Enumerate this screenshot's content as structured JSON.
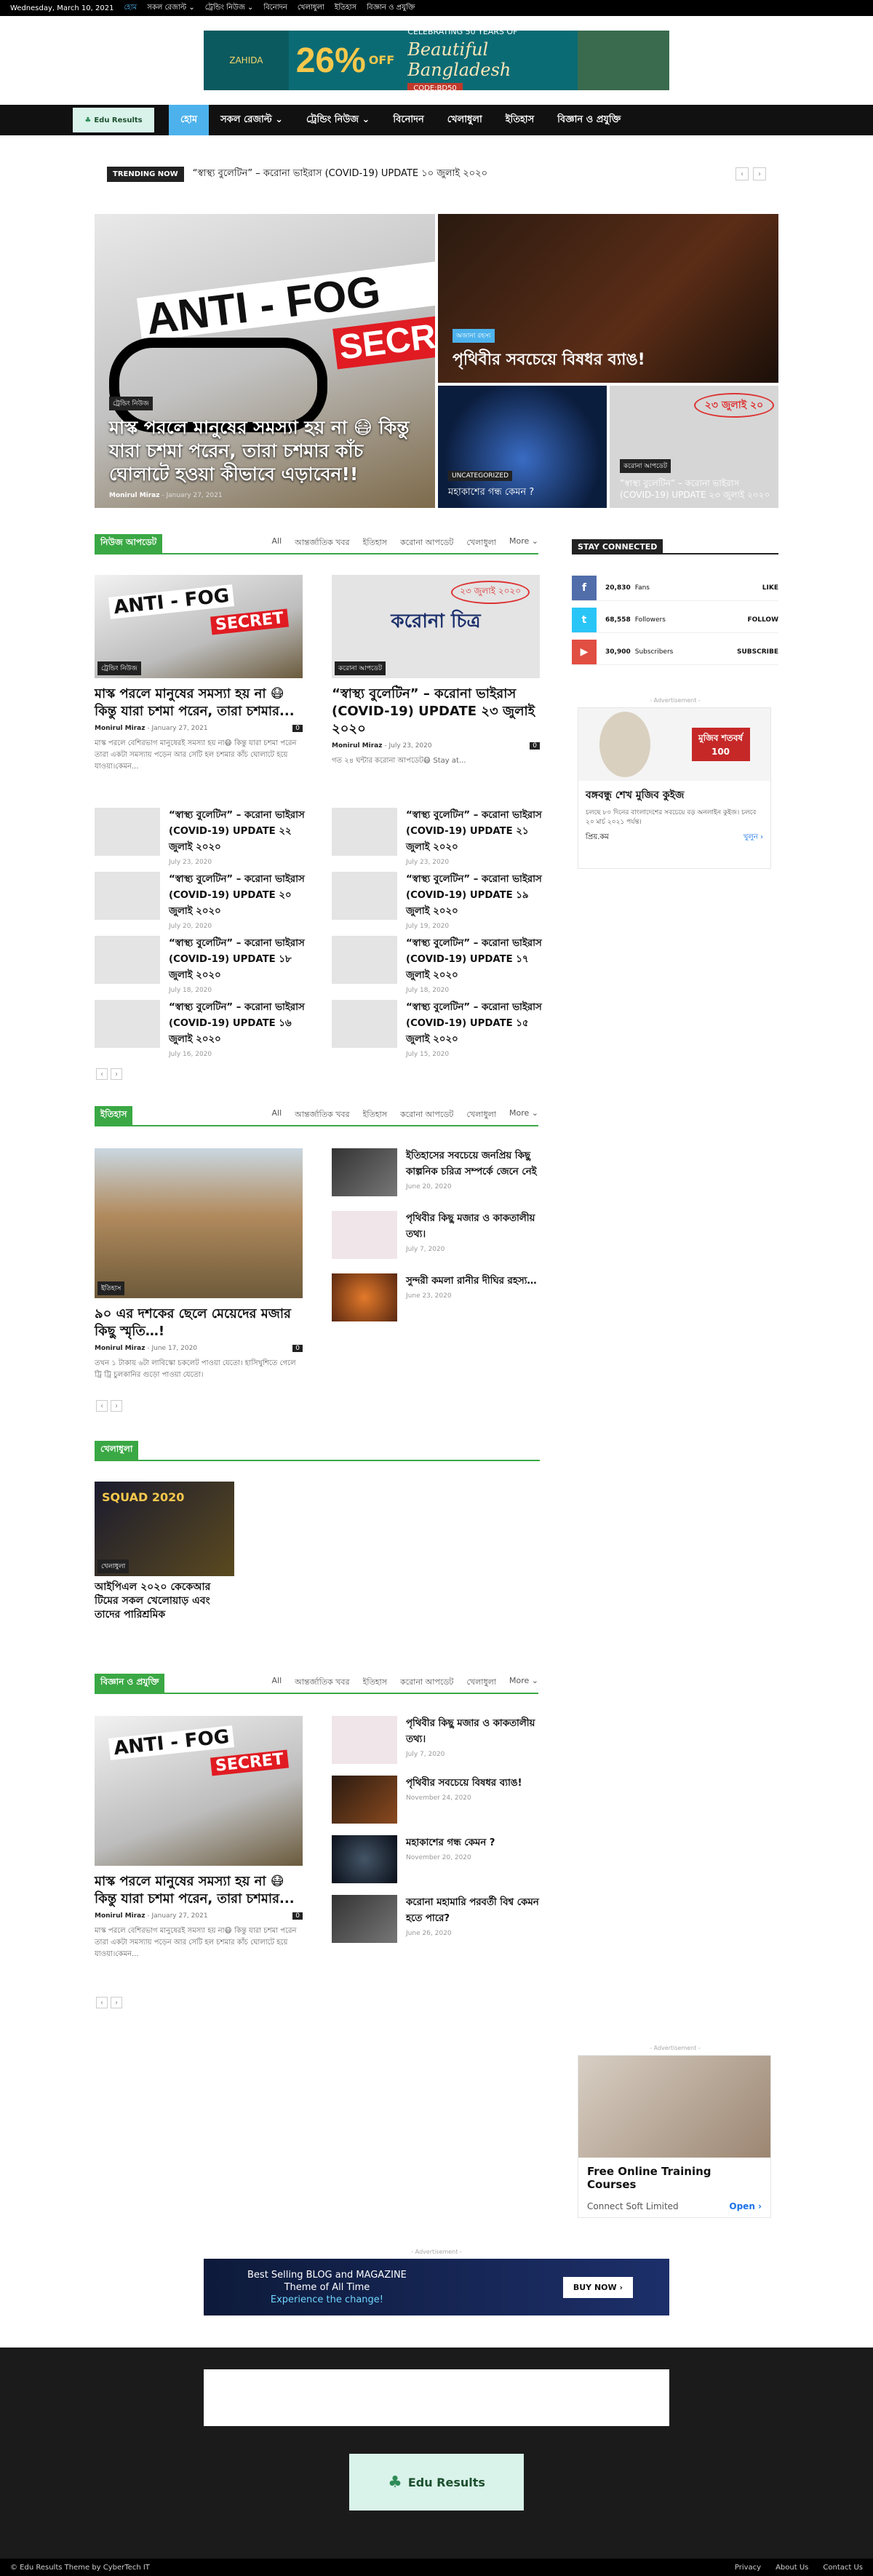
{
  "topbar": {
    "date": "Wednesday, March 10, 2021",
    "items": [
      "হোম",
      "সকল রেজাল্ট ⌄",
      "ট্রেন্ডিং নিউজ ⌄",
      "বিনোদন",
      "খেলাধুলা",
      "ইতিহাস",
      "বিজ্ঞান ও প্রযুক্তি"
    ]
  },
  "top_ad": {
    "brand": "ZAHIDA",
    "percent": "26%",
    "off": "OFF",
    "line1": "CELEBRATING 50 YEARS OF",
    "line2": "Beautiful Bangladesh",
    "code": "CODE:BD50"
  },
  "nav": {
    "logo_text": "Edu Results",
    "items": [
      "হোম",
      "সকল রেজাল্ট ⌄",
      "ট্রেন্ডিং নিউজ ⌄",
      "বিনোদন",
      "খেলাধুলা",
      "ইতিহাস",
      "বিজ্ঞান ও প্রযুক্তি"
    ]
  },
  "trending": {
    "label": "TRENDING NOW",
    "text": "“স্বাস্থ্য বুলেটিন” – করোনা ভাইরাস (COVID-19) UPDATE ১০ জুলাই ২০২০"
  },
  "hero": {
    "main": {
      "banner1": "ANTI - FOG",
      "banner2": "SECRET",
      "category": "ট্রেন্ডিং নিউজ",
      "title": "মাস্ক পরলে মানুষের সমস্যা হয় না 😷 কিন্তু যারা চশমা পরেন, তারা চশমার কাঁচ ঘোলাটে হওয়া কীভাবে এড়াবেন!!",
      "author": "Monirul Miraz",
      "date": "January 27, 2021"
    },
    "top_right": {
      "category": "অজানা রহস্য",
      "title": "পৃথিবীর সবচেয়ে বিষধর ব্যাঙ!"
    },
    "bottom_left": {
      "category": "UNCATEGORIZED",
      "title": "মহাকাশের গন্ধ কেমন ?"
    },
    "bottom_right": {
      "category": "করোনা আপডেট",
      "stamp": "২৩ জুলাই ২০",
      "title": "“স্বাস্থ্য বুলেটিন” – করোনা ভাইরাস (COVID-19) UPDATE ২৩ জুলাই ২০২০"
    }
  },
  "sec_news": {
    "title": "নিউজ আপডেট",
    "tabs": [
      "All",
      "আন্তর্জাতিক খবর",
      "ইতিহাস",
      "করোনা আপডেট",
      "খেলাধুলা",
      "More ⌄"
    ],
    "big1": {
      "category": "ট্রেন্ডিং নিউজ",
      "title": "মাস্ক পরলে মানুষের সমস্যা হয় না 😷 কিন্তু যারা চশমা পরেন, তারা চশমার...",
      "author": "Monirul Miraz",
      "date": "January 27, 2021",
      "comments": "0",
      "excerpt": "মাস্ক পরলে বেশিরভাগ মানুষেরই সমস্যা হয় না😷 কিন্তু যারা চশমা পরেন তারা একটা সমস্যায় পড়েন আর সেটি হল চশমার কাঁচ ঘোলাটে হয়ে যাওয়া।কেমন..."
    },
    "big2": {
      "category": "করোনা আপডেট",
      "stamp": "২৩ জুলাই ২০২০",
      "banner": "করোনা চিত্র",
      "title": "“স্বাস্থ্য বুলেটিন” – করোনা ভাইরাস (COVID-19) UPDATE ২৩ জুলাই ২০২০",
      "author": "Monirul Miraz",
      "date": "July 23, 2020",
      "comments": "0",
      "excerpt": "গত ২৪ ঘন্টার করোনা আপডেট😷 Stay at..."
    },
    "small": [
      {
        "title": "“স্বাস্থ্য বুলেটিন” – করোনা ভাইরাস (COVID-19) UPDATE ২২ জুলাই ২০২০",
        "date": "July 23, 2020"
      },
      {
        "title": "“স্বাস্থ্য বুলেটিন” – করোনা ভাইরাস (COVID-19) UPDATE ২১ জুলাই ২০২০",
        "date": "July 23, 2020"
      },
      {
        "title": "“স্বাস্থ্য বুলেটিন” – করোনা ভাইরাস (COVID-19) UPDATE ২০ জুলাই ২০২০",
        "date": "July 20, 2020"
      },
      {
        "title": "“স্বাস্থ্য বুলেটিন” – করোনা ভাইরাস (COVID-19) UPDATE ১৯ জুলাই ২০২০",
        "date": "July 19, 2020"
      },
      {
        "title": "“স্বাস্থ্য বুলেটিন” – করোনা ভাইরাস (COVID-19) UPDATE ১৮ জুলাই ২০২০",
        "date": "July 18, 2020"
      },
      {
        "title": "“স্বাস্থ্য বুলেটিন” – করোনা ভাইরাস (COVID-19) UPDATE ১৭ জুলাই ২০২০",
        "date": "July 18, 2020"
      },
      {
        "title": "“স্বাস্থ্য বুলেটিন” – করোনা ভাইরাস (COVID-19) UPDATE ১৬ জুলাই ২০২০",
        "date": "July 16, 2020"
      },
      {
        "title": "“স্বাস্থ্য বুলেটিন” – করোনা ভাইরাস (COVID-19) UPDATE ১৫ জুলাই ২০২০",
        "date": "July 15, 2020"
      }
    ]
  },
  "sidebar": {
    "title": "STAY CONNECTED",
    "social": [
      {
        "icon": "f",
        "count": "20,830",
        "label": "Fans",
        "action": "LIKE",
        "color": "#516eab"
      },
      {
        "icon": "t",
        "count": "68,558",
        "label": "Followers",
        "action": "FOLLOW",
        "color": "#29c5f6"
      },
      {
        "icon": "▶",
        "count": "30,900",
        "label": "Subscribers",
        "action": "SUBSCRIBE",
        "color": "#e14e42"
      }
    ],
    "ad1": {
      "label": "- Advertisement -",
      "headline": "বঙ্গবন্ধু শেখ মুজিব কুইজ",
      "badge": "মুজিব শতবর্ষ 100",
      "desc": "চলছে ৮০ দিনের বাংলাদেশের সবচেয়ে বড় অনলাইন কুইজ। চলবে ২০ মার্চ ২০২১ পর্যন্ত।",
      "brand": "প্রিয়.কম",
      "cta": "খুলুন ›"
    },
    "ad2": {
      "label": "- Advertisement -",
      "headline": "Free Online Training Courses",
      "brand": "Connect Soft Limited",
      "cta": "Open ›"
    }
  },
  "sec_history": {
    "title": "ইতিহাস",
    "tabs": [
      "All",
      "আন্তর্জাতিক খবর",
      "ইতিহাস",
      "করোনা আপডেট",
      "খেলাধুলা",
      "More ⌄"
    ],
    "big": {
      "category": "ইতিহাস",
      "title": "৯০ এর দশকের ছেলে মেয়েদের মজার কিছু স্মৃতি…!",
      "author": "Monirul Miraz",
      "date": "June 17, 2020",
      "comments": "0",
      "excerpt": "তখন ১ টাকায় ৬টা লাবিস্কো চকলেট পাওয়া যেতো। হাসিখুশিতে গেলে ট্রি ট্রি চুলকানির গুড়ো পাওয়া যেতো।"
    },
    "small": [
      {
        "title": "ইতিহাসের সবচেয়ে জনপ্রিয় কিছু কাল্পনিক চরিত্র সম্পর্কে জেনে নেই",
        "date": "June 20, 2020"
      },
      {
        "title": "পৃথিবীর কিছু মজার ও কাকতালীয় তথ্য।",
        "date": "July 7, 2020"
      },
      {
        "title": "সুন্দরী কমলা রানীর দীঘির রহস্য…",
        "date": "June 23, 2020"
      }
    ]
  },
  "sec_sports": {
    "title": "খেলাধুলা",
    "card": {
      "category": "খেলাধুলা",
      "thumb_text": "SQUAD 2020",
      "title": "আইপিএল ২০২০ কেকেআর টিমের সকল খেলোয়াড় এবং তাদের পারিশ্রমিক"
    }
  },
  "sec_science": {
    "title": "বিজ্ঞান ও প্রযুক্তি",
    "tabs": [
      "All",
      "আন্তর্জাতিক খবর",
      "ইতিহাস",
      "করোনা আপডেট",
      "খেলাধুলা",
      "More ⌄"
    ],
    "big": {
      "title": "মাস্ক পরলে মানুষের সমস্যা হয় না 😷 কিন্তু যারা চশমা পরেন, তারা চশমার...",
      "author": "Monirul Miraz",
      "date": "January 27, 2021",
      "comments": "0",
      "excerpt": "মাস্ক পরলে বেশিরভাগ মানুষেরই সমস্যা হয় না😷 কিন্তু যারা চশমা পরেন তারা একটা সমস্যায় পড়েন আর সেটি হল চশমার কাঁচ ঘোলাটে হয়ে যাওয়া।কেমন..."
    },
    "small": [
      {
        "title": "পৃথিবীর কিছু মজার ও কাকতালীয় তথ্য।",
        "date": "July 7, 2020"
      },
      {
        "title": "পৃথিবীর সবচেয়ে বিষধর ব্যাঙ!",
        "date": "November 24, 2020"
      },
      {
        "title": "মহাকাশের গন্ধ কেমন ?",
        "date": "November 20, 2020"
      },
      {
        "title": "করোনা মহামারি পরবর্তী বিশ্ব কেমন হতে পারে?",
        "date": "June 26, 2020"
      }
    ]
  },
  "bottom_ad": {
    "label": "- Advertisement -",
    "line1": "Best Selling BLOG and MAGAZINE",
    "line2": "Theme of All Time",
    "line3": "Experience the change!",
    "cta": "BUY NOW ›"
  },
  "footer": {
    "logo_text": "Edu Results",
    "copyright": "© Edu Results Theme by CyberTech IT",
    "links": [
      "Privacy",
      "About Us",
      "Contact Us"
    ]
  }
}
